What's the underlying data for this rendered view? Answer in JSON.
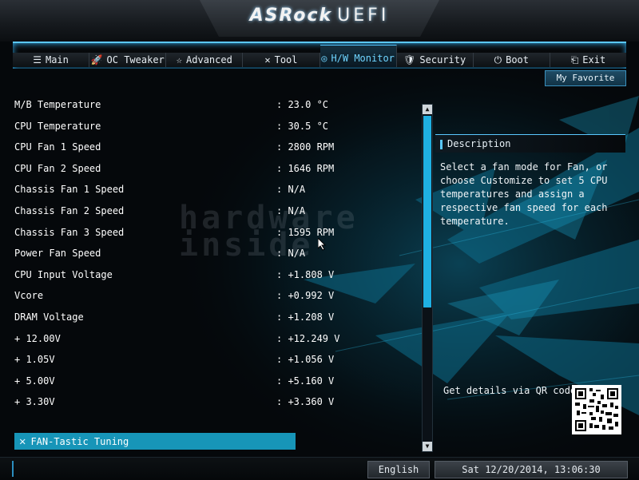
{
  "header": {
    "brand": "ASRock",
    "product": "UEFI"
  },
  "tabs": [
    {
      "icon": "☰",
      "label": "Main"
    },
    {
      "icon": "🚀",
      "label": "OC Tweaker"
    },
    {
      "icon": "☆",
      "label": "Advanced"
    },
    {
      "icon": "✕",
      "label": "Tool"
    },
    {
      "icon": "◎",
      "label": "H/W Monitor",
      "active": true
    },
    {
      "icon": "🛡",
      "label": "Security"
    },
    {
      "icon": "⏻",
      "label": "Boot"
    },
    {
      "icon": "⎗",
      "label": "Exit"
    }
  ],
  "my_favorite": "My Favorite",
  "monitor": {
    "rows": [
      {
        "label": "M/B Temperature",
        "value": ": 23.0 °C"
      },
      {
        "label": "CPU Temperature",
        "value": ": 30.5 °C"
      },
      {
        "label": "CPU Fan 1 Speed",
        "value": ": 2800 RPM"
      },
      {
        "label": "CPU Fan 2 Speed",
        "value": ": 1646 RPM"
      },
      {
        "label": "Chassis Fan 1 Speed",
        "value": ": N/A"
      },
      {
        "label": "Chassis Fan 2 Speed",
        "value": ": N/A"
      },
      {
        "label": "Chassis Fan 3 Speed",
        "value": ": 1595 RPM"
      },
      {
        "label": "Power Fan Speed",
        "value": ": N/A"
      },
      {
        "label": "CPU Input Voltage",
        "value": ": +1.808 V"
      },
      {
        "label": "Vcore",
        "value": ": +0.992 V"
      },
      {
        "label": "DRAM Voltage",
        "value": ": +1.208 V"
      },
      {
        "label": "+ 12.00V",
        "value": ": +12.249 V"
      },
      {
        "label": "+ 1.05V",
        "value": ": +1.056 V"
      },
      {
        "label": "+ 5.00V",
        "value": ": +5.160 V"
      },
      {
        "label": "+ 3.30V",
        "value": ": +3.360 V"
      }
    ]
  },
  "fan_tuning": {
    "label": "FAN-Tastic Tuning"
  },
  "description": {
    "title": "Description",
    "text": "Select a fan mode for Fan, or\nchoose Customize to set 5 CPU\ntemperatures and assign a\nrespective fan speed for each\ntemperature.",
    "qr_label": "Get details via QR code"
  },
  "watermark": {
    "line1": "hardware",
    "line2": "inside"
  },
  "footer": {
    "language": "English",
    "datetime": "Sat 12/20/2014, 13:06:30"
  },
  "colors": {
    "accent": "#1fb0e2",
    "highlight_bar": "#1795b8",
    "background": "#05080b"
  }
}
